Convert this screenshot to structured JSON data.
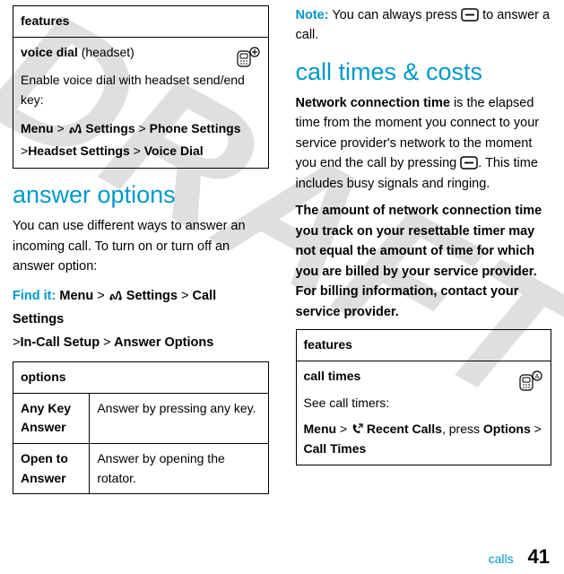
{
  "left": {
    "table1": {
      "header": "features",
      "row_title_bold": "voice dial",
      "row_title_rest": " (headset)",
      "row_desc": "Enable voice dial with headset send/end key:",
      "path": {
        "menu": "Menu",
        "settings": "Settings",
        "phone": "Phone Settings",
        "headset": "Headset Settings",
        "voice": "Voice Dial"
      }
    },
    "h_answer": "answer options",
    "answer_intro": "You can use different ways to answer an incoming call. To turn on or turn off an answer option:",
    "find_label": "Find it:",
    "find_path": {
      "menu": "Menu",
      "settings": "Settings",
      "callset": "Call Settings",
      "incall": "In-Call Setup",
      "answopt": "Answer Options"
    },
    "table2": {
      "header": "options",
      "r1c1": "Any Key Answer",
      "r1c2": "Answer by pressing any key.",
      "r2c1": "Open to Answer",
      "r2c2": "Answer by opening the rotator."
    }
  },
  "right": {
    "note_label": "Note:",
    "note_text1": " You can always press ",
    "note_text2": " to answer a call.",
    "h_times": "call times & costs",
    "nct_bold": "Network connection time",
    "nct_text1": " is the elapsed time from the moment you connect to your service provider's network to the moment you end the call by pressing ",
    "nct_text2": ". This time includes busy signals and ringing.",
    "warn": "The amount of network connection time you track on your resettable timer may not equal the amount of time for which you are billed by your service provider. For billing information, contact your service provider.",
    "table3": {
      "header": "features",
      "row_title": "call times",
      "row_desc": "See call timers:",
      "path": {
        "menu": "Menu",
        "recent": "Recent Calls",
        "press": ", press ",
        "options": "Options",
        "call_times": "Call Times"
      }
    }
  },
  "footer": {
    "label": "calls",
    "page": "41"
  }
}
